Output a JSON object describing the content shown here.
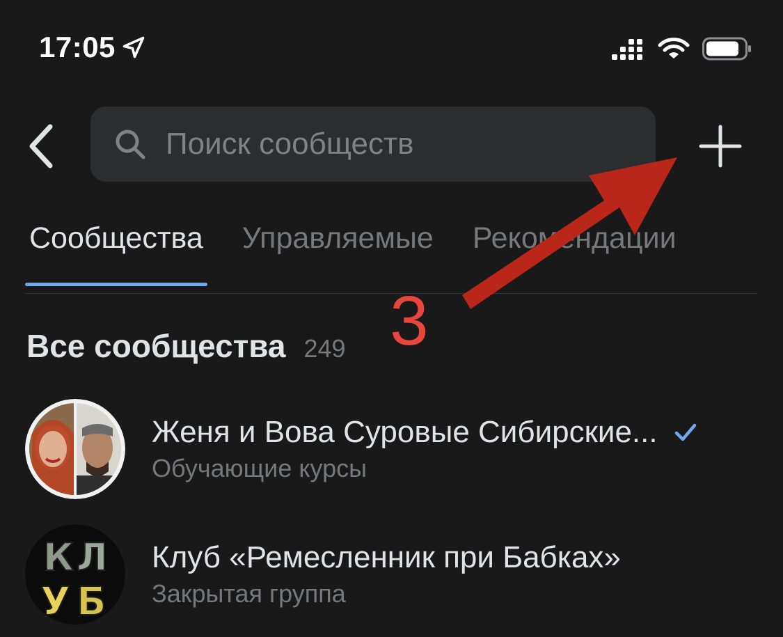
{
  "status_bar": {
    "time": "17:05"
  },
  "search": {
    "placeholder": "Поиск сообществ"
  },
  "tabs": [
    {
      "label": "Сообщества",
      "active": true
    },
    {
      "label": "Управляемые",
      "active": false
    },
    {
      "label": "Рекомендации",
      "active": false
    }
  ],
  "section": {
    "title": "Все сообщества",
    "count": "249"
  },
  "communities": [
    {
      "title": "Женя и Вова Суровые Сибирские...",
      "subtitle": "Обучающие курсы",
      "verified": true
    },
    {
      "title": "Клуб «Ремесленник при Бабках»",
      "subtitle": "Закрытая группа",
      "verified": false
    }
  ],
  "annotation": {
    "number": "3",
    "color": "#e8463d"
  },
  "colors": {
    "background": "#19191a",
    "accent": "#71aaeb",
    "search_bg": "#2c2d2e",
    "arrow": "#b8271a"
  }
}
